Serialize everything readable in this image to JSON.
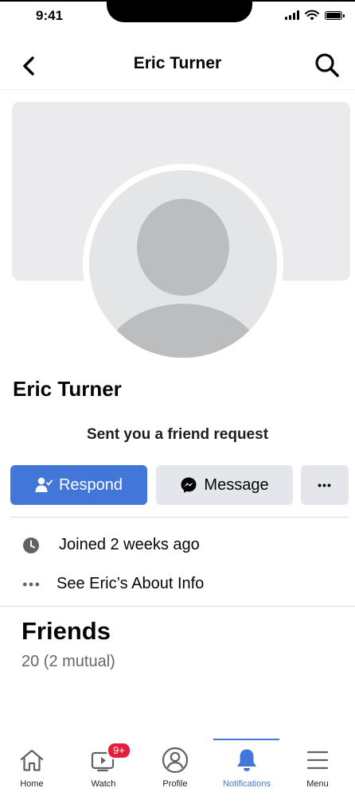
{
  "status_bar": {
    "time": "9:41"
  },
  "header": {
    "title": "Eric Turner"
  },
  "profile": {
    "name": "Eric Turner",
    "request_text": "Sent you a friend request"
  },
  "actions": {
    "respond_label": "Respond",
    "message_label": "Message",
    "more_label": "•••"
  },
  "info": {
    "joined": "Joined 2 weeks ago",
    "about": "See Eric’s About Info"
  },
  "friends": {
    "title": "Friends",
    "count": "20 (2 mutual)"
  },
  "tab_bar": {
    "items": [
      {
        "label": "Home",
        "icon": "home-icon"
      },
      {
        "label": "Watch",
        "icon": "watch-icon",
        "badge": "9+"
      },
      {
        "label": "Profile",
        "icon": "profile-icon"
      },
      {
        "label": "Notifications",
        "icon": "bell-icon",
        "active": true
      },
      {
        "label": "Menu",
        "icon": "menu-icon"
      }
    ]
  },
  "colors": {
    "accent": "#4276d9",
    "badge": "#e41e3f",
    "secondary_button": "#e4e6eb",
    "muted_text": "#65676b"
  }
}
